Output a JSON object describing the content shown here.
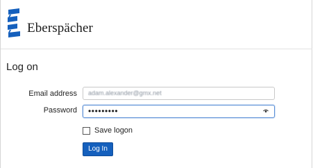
{
  "header": {
    "brand": "Eberspächer",
    "logo_color": "#1560bd"
  },
  "form": {
    "title": "Log on",
    "email_label": "Email address",
    "email_value": "adam.alexander@gmx.net",
    "password_label": "Password",
    "password_mask": "•••••••••",
    "save_logon_label": "Save logon",
    "save_logon_checked": false,
    "login_button": "Log In"
  },
  "colors": {
    "accent": "#1560bd",
    "focus_border": "#5a8fd6"
  }
}
